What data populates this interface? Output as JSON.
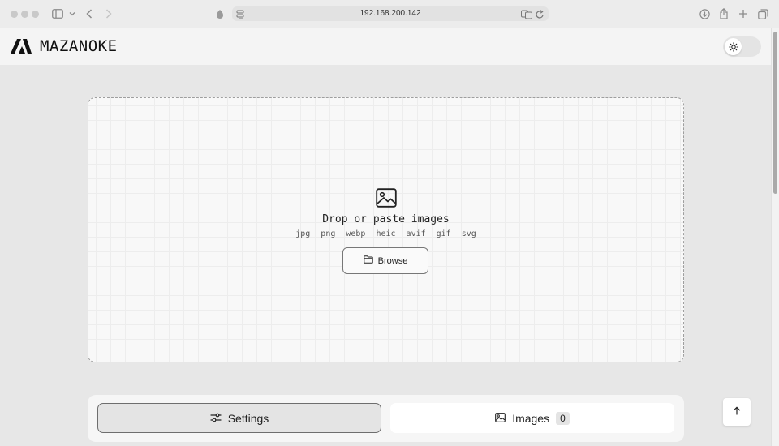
{
  "browser": {
    "url": "192.168.200.142"
  },
  "app": {
    "title": "MAZANOKE"
  },
  "dropzone": {
    "title": "Drop or paste images",
    "formats": [
      "jpg",
      "png",
      "webp",
      "heic",
      "avif",
      "gif",
      "svg"
    ],
    "browse_label": "Browse"
  },
  "tabs": {
    "settings_label": "Settings",
    "images_label": "Images",
    "images_count": "0"
  },
  "icons": {
    "logo": "mazanoke-logo",
    "theme": "sun-icon",
    "drop": "image-icon",
    "browse": "folder-icon",
    "settings": "sliders-icon",
    "images": "image-icon",
    "scroll_top": "arrow-up-icon"
  }
}
